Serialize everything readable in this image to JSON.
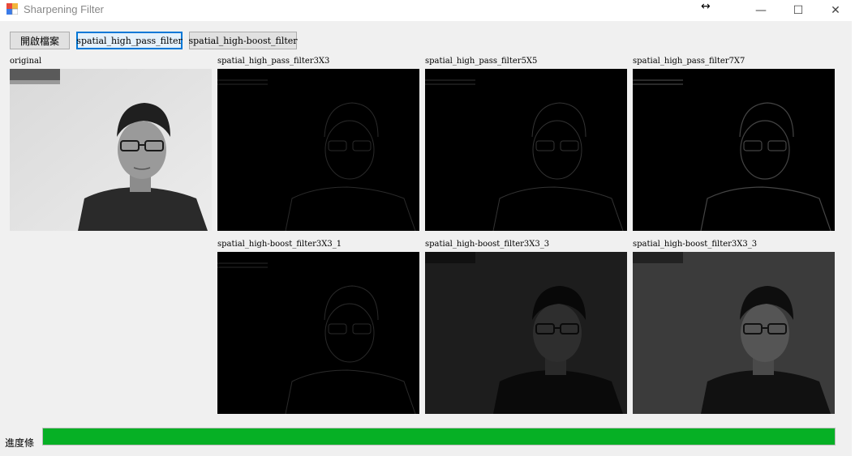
{
  "window": {
    "title": "Sharpening Filter",
    "minimize_glyph": "—",
    "maximize_glyph": "☐",
    "close_glyph": "✕",
    "cursor_glyph": "↔"
  },
  "toolbar": {
    "open_file_label": "開啟檔案",
    "high_pass_label": "spatial_high_pass_filter",
    "high_boost_label": "spatial_high-boost_filter"
  },
  "panels": {
    "original": "original",
    "hp3": "spatial_high_pass_filter3X3",
    "hp5": "spatial_high_pass_filter5X5",
    "hp7": "spatial_high_pass_filter7X7",
    "hb1": "spatial_high-boost_filter3X3_1",
    "hb2": "spatial_high-boost_filter3X3_3",
    "hb3": "spatial_high-boost_filter3X3_3"
  },
  "progress": {
    "label": "進度條",
    "percent": 100,
    "color": "#06b025"
  },
  "colors": {
    "accent": "#0078d7"
  }
}
